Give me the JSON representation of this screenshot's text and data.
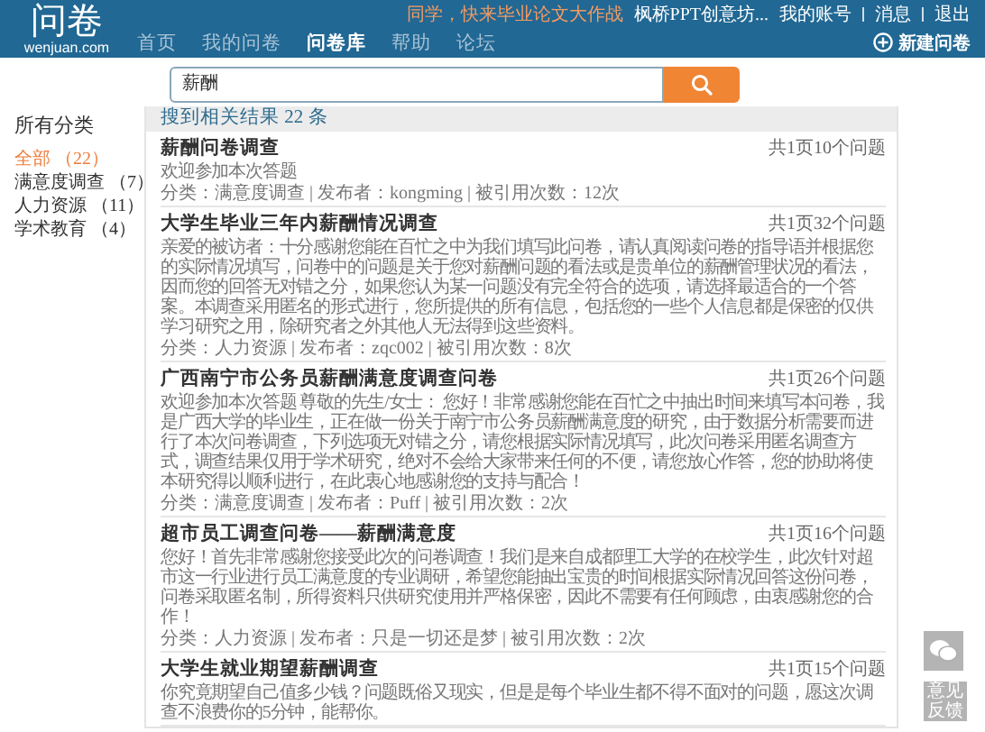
{
  "header": {
    "logo": "问卷",
    "logo_domain": "wenjuan.com",
    "promo": "同学，快来毕业论文大作战",
    "user": "枫桥PPT创意坊...",
    "links": [
      {
        "label": "我的账号"
      },
      {
        "label": "消息"
      },
      {
        "label": "退出"
      }
    ],
    "nav": [
      {
        "label": "首页",
        "selected": false
      },
      {
        "label": "我的问卷",
        "selected": false
      },
      {
        "label": "问卷库",
        "selected": true
      },
      {
        "label": "帮助",
        "selected": false
      },
      {
        "label": "论坛",
        "selected": false
      }
    ],
    "new_button": "新建问卷"
  },
  "search": {
    "value": "薪酬"
  },
  "sidebar": {
    "title": "所有分类",
    "items": [
      {
        "label": "全部",
        "count": "（22）",
        "selected": true
      },
      {
        "label": "满意度调查",
        "count": "（7）",
        "selected": false
      },
      {
        "label": "人力资源",
        "count": "（11）",
        "selected": false
      },
      {
        "label": "学术教育",
        "count": "（4）",
        "selected": false
      }
    ]
  },
  "results": {
    "summary": "搜到相关结果 22 条",
    "items": [
      {
        "title": "薪酬问卷调查",
        "pages": "共1页10个问题",
        "description": "欢迎参加本次答题",
        "meta": "分类：满意度调查 | 发布者：kongming | 被引用次数：12次"
      },
      {
        "title": "大学生毕业三年内薪酬情况调查",
        "pages": "共1页32个问题",
        "description": "亲爱的被访者：十分感谢您能在百忙之中为我们填写此问卷，请认真阅读问卷的指导语并根据您的实际情况填写，问卷中的问题是关于您对薪酬问题的看法或是贵单位的薪酬管理状况的看法，因而您的回答无对错之分，如果您认为某一问题没有完全符合的选项，请选择最适合的一个答案。本调查采用匿名的形式进行，您所提供的所有信息，包括您的一些个人信息都是保密的仅供学习研究之用，除研究者之外其他人无法得到这些资料。",
        "meta": "分类：人力资源 | 发布者：zqc002 | 被引用次数：8次"
      },
      {
        "title": "广西南宁市公务员薪酬满意度调查问卷",
        "pages": "共1页26个问题",
        "description": "欢迎参加本次答题 尊敬的先生/女士： 您好！非常感谢您能在百忙之中抽出时间来填写本问卷，我是广西大学的毕业生，正在做一份关于南宁市公务员薪酬满意度的研究，由于数据分析需要而进行了本次问卷调查，下列选项无对错之分，请您根据实际情况填写，此次问卷采用匿名调查方式，调查结果仅用于学术研究，绝对不会给大家带来任何的不便，请您放心作答，您的协助将使本研究得以顺利进行，在此衷心地感谢您的支持与配合！",
        "meta": "分类：满意度调查 | 发布者：Puff | 被引用次数：2次"
      },
      {
        "title": "超市员工调查问卷——薪酬满意度",
        "pages": "共1页16个问题",
        "description": "您好！首先非常感谢您接受此次的问卷调查！我们是来自成都理工大学的在校学生，此次针对超市这一行业进行员工满意度的专业调研，希望您能抽出宝贵的时间根据实际情况回答这份问卷，问卷采取匿名制，所得资料只供研究使用并严格保密，因此不需要有任何顾虑，由衷感谢您的合作！",
        "meta": "分类：人力资源 | 发布者：只是一切还是梦 | 被引用次数：2次"
      },
      {
        "title": "大学生就业期望薪酬调查",
        "pages": "共1页15个问题",
        "description": "你究竟期望自己值多少钱？问题既俗又现实，但是是每个毕业生都不得不面对的问题，愿这次调查不浪费你的5分钟，能帮你。"
      }
    ]
  },
  "float": {
    "feedback": "意见反馈"
  }
}
